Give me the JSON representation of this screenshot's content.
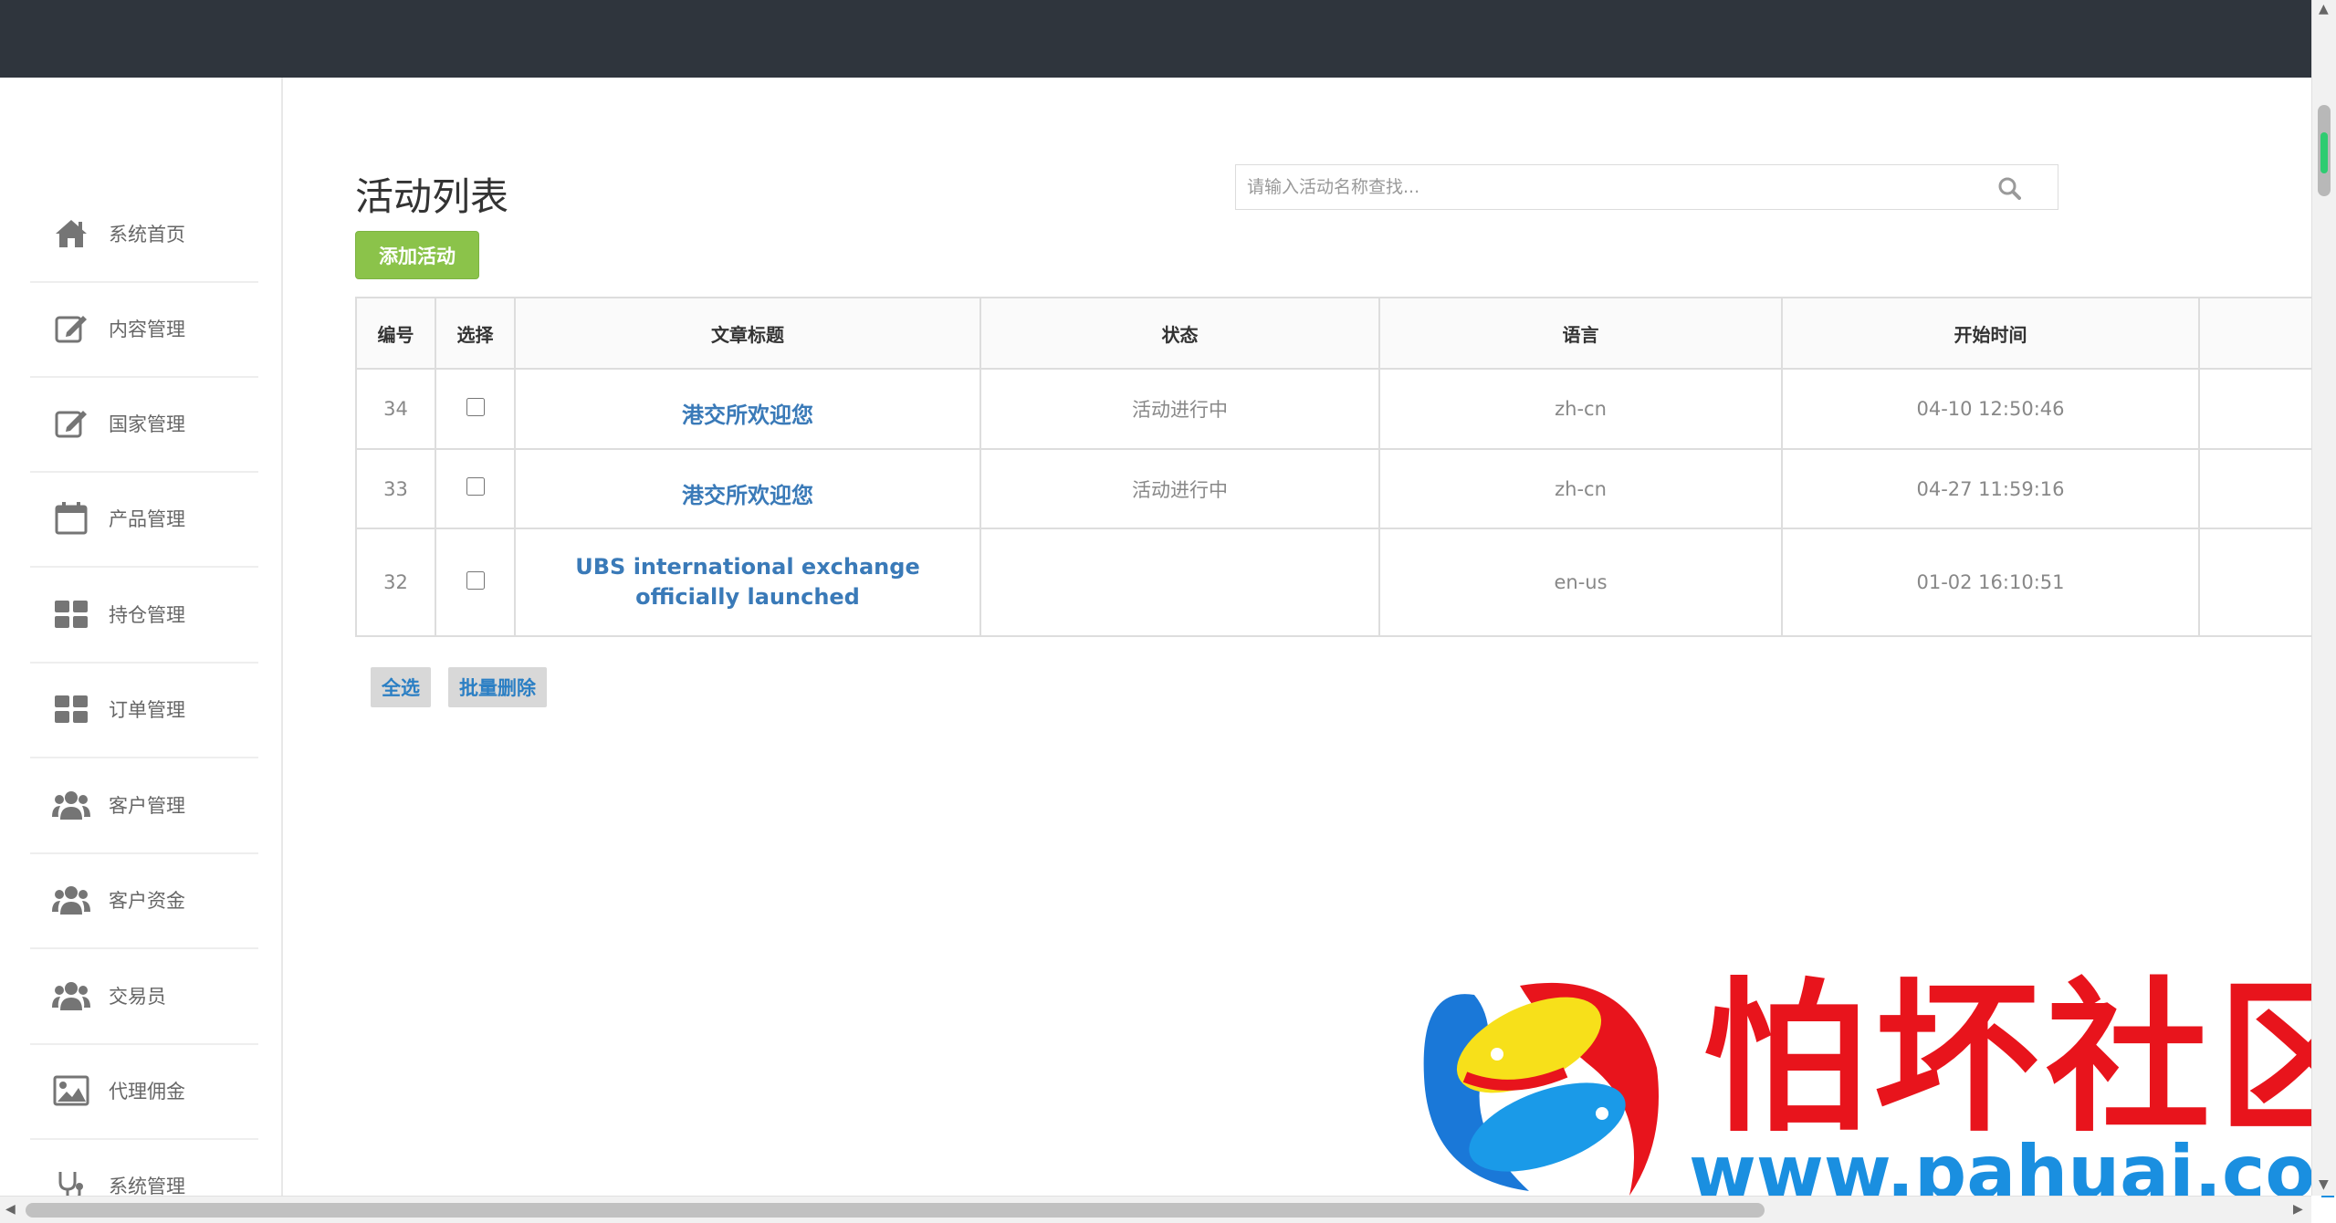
{
  "sidebar": {
    "items": [
      {
        "label": "系统首页",
        "icon": "home-icon"
      },
      {
        "label": "内容管理",
        "icon": "edit-icon"
      },
      {
        "label": "国家管理",
        "icon": "edit-icon"
      },
      {
        "label": "产品管理",
        "icon": "calendar-icon"
      },
      {
        "label": "持仓管理",
        "icon": "grid-icon"
      },
      {
        "label": "订单管理",
        "icon": "grid-icon"
      },
      {
        "label": "客户管理",
        "icon": "users-icon"
      },
      {
        "label": "客户资金",
        "icon": "users-icon"
      },
      {
        "label": "交易员",
        "icon": "users-icon"
      },
      {
        "label": "代理佣金",
        "icon": "image-icon"
      },
      {
        "label": "系统管理",
        "icon": "stethoscope-icon"
      }
    ]
  },
  "page": {
    "title": "活动列表",
    "add_button": "添加活动",
    "search_placeholder": "请输入活动名称查找..."
  },
  "table": {
    "headers": {
      "id": "编号",
      "select": "选择",
      "title": "文章标题",
      "status": "状态",
      "lang": "语言",
      "start": "开始时间"
    },
    "rows": [
      {
        "id": "34",
        "title": "港交所欢迎您",
        "status": "活动进行中",
        "lang": "zh-cn",
        "start": "04-10 12:50:46"
      },
      {
        "id": "33",
        "title": "港交所欢迎您",
        "status": "活动进行中",
        "lang": "zh-cn",
        "start": "04-27 11:59:16"
      },
      {
        "id": "32",
        "title": "UBS international exchange officially launched",
        "status": "",
        "lang": "en-us",
        "start": "01-02 16:10:51"
      }
    ]
  },
  "actions": {
    "select_all": "全选",
    "batch_delete": "批量删除"
  },
  "watermark": {
    "text": "怕坏社区",
    "url": "www.pahuai.com"
  },
  "colors": {
    "topbar": "#2f353d",
    "add_button": "#8bc34a",
    "link": "#3a7ab8",
    "status_active": "#3c8a2e"
  }
}
